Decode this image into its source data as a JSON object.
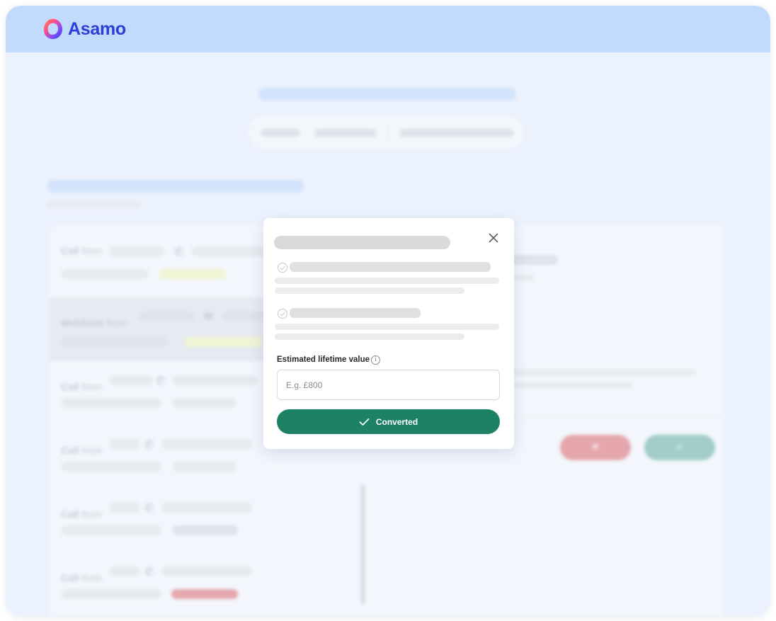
{
  "brand": {
    "name": "Asamo"
  },
  "background": {
    "rows": [
      {
        "type": "Call",
        "from": "from"
      },
      {
        "type": "Webform",
        "from": "from"
      },
      {
        "type": "Call",
        "from": "from"
      },
      {
        "type": "Call",
        "from": "from"
      },
      {
        "type": "Call",
        "from": "from"
      },
      {
        "type": "Call",
        "from": "from"
      }
    ],
    "reject_button_icon": "✕",
    "accept_button_icon": "✓"
  },
  "modal": {
    "field_label": "Estimated lifetime value",
    "info_icon": "i",
    "input_placeholder": "E.g. £800",
    "input_value": "",
    "submit_label": "Converted"
  },
  "colors": {
    "brand": "#2b3fd6",
    "header": "#c2dafc",
    "primary_button": "#1d8265",
    "reject": "#e5a7ad",
    "accept": "#a3cdc8"
  },
  "icons": [
    "asamo-logo-icon",
    "phone-icon",
    "mail-icon",
    "close-icon",
    "check-circle-icon",
    "info-icon",
    "check-icon"
  ]
}
